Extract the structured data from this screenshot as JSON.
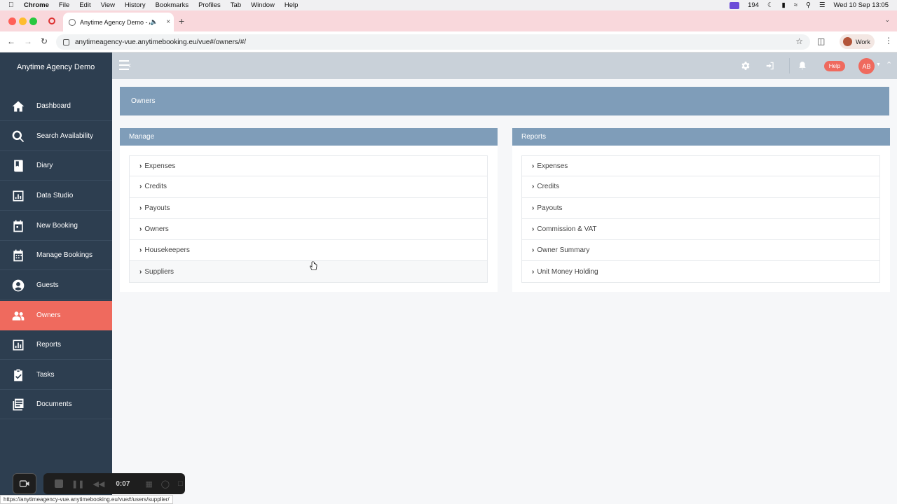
{
  "macos_menubar": {
    "app": "Chrome",
    "menus": [
      "File",
      "Edit",
      "View",
      "History",
      "Bookmarks",
      "Profiles",
      "Tab",
      "Window",
      "Help"
    ],
    "notification_count": "194",
    "datetime": "Wed 10 Sep  13:05"
  },
  "browser": {
    "tab_title": "Anytime Agency Demo - A",
    "tab_close": "×",
    "new_tab": "+",
    "url": "anytimeagency-vue.anytimebooking.eu/vue#/owners/#/",
    "profile_label": "Work",
    "status_url": "https://anytimeagency-vue.anytimebooking.eu/vue#/users/supplier/"
  },
  "sidebar": {
    "brand": "Anytime Agency Demo",
    "items": [
      {
        "label": "Dashboard",
        "icon": "home-icon"
      },
      {
        "label": "Search Availability",
        "icon": "search-icon"
      },
      {
        "label": "Diary",
        "icon": "book-icon"
      },
      {
        "label": "Data Studio",
        "icon": "chart-icon"
      },
      {
        "label": "New Booking",
        "icon": "calendar-plus-icon"
      },
      {
        "label": "Manage Bookings",
        "icon": "calendar-icon"
      },
      {
        "label": "Guests",
        "icon": "user-circle-icon"
      },
      {
        "label": "Owners",
        "icon": "users-icon",
        "active": true
      },
      {
        "label": "Reports",
        "icon": "bar-chart-icon"
      },
      {
        "label": "Tasks",
        "icon": "clipboard-check-icon"
      },
      {
        "label": "Documents",
        "icon": "documents-icon"
      }
    ]
  },
  "topbar": {
    "help_label": "Help",
    "avatar_initials": "AB"
  },
  "page": {
    "title": "Owners"
  },
  "manage": {
    "title": "Manage",
    "items": [
      "Expenses",
      "Credits",
      "Payouts",
      "Owners",
      "Housekeepers",
      "Suppliers"
    ]
  },
  "reports": {
    "title": "Reports",
    "items": [
      "Expenses",
      "Credits",
      "Payouts",
      "Commission & VAT",
      "Owner Summary",
      "Unit Money Holding"
    ]
  },
  "recorder": {
    "time": "0:07"
  },
  "colors": {
    "sidebar_bg": "#2d3e50",
    "accent": "#ef6a5e",
    "panel_header": "#7f9db9",
    "topbar_bg": "#c9d1d9"
  }
}
